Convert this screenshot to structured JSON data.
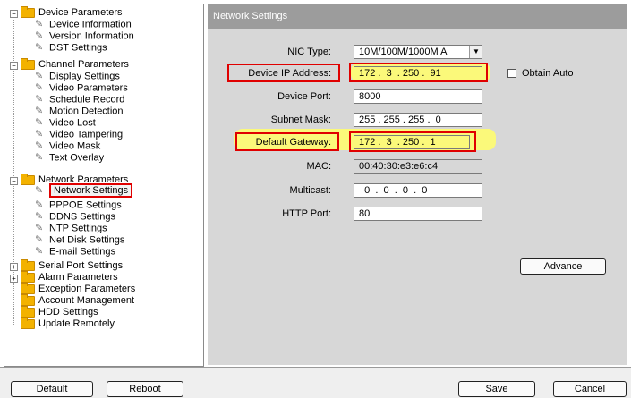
{
  "tree": {
    "device_parameters": "Device Parameters",
    "device_information": "Device Information",
    "version_information": "Version Information",
    "dst_settings": "DST Settings",
    "channel_parameters": "Channel Parameters",
    "display_settings": "Display Settings",
    "video_parameters": "Video Parameters",
    "schedule_record": "Schedule Record",
    "motion_detection": "Motion Detection",
    "video_lost": "Video Lost",
    "video_tampering": "Video Tampering",
    "video_mask": "Video Mask",
    "text_overlay": "Text Overlay",
    "network_parameters": "Network Parameters",
    "network_settings": "Network Settings",
    "pppoe_settings": "PPPOE Settings",
    "ddns_settings": "DDNS Settings",
    "ntp_settings": "NTP Settings",
    "net_disk_settings": "Net Disk Settings",
    "email_settings": "E-mail Settings",
    "serial_port_settings": "Serial Port Settings",
    "alarm_parameters": "Alarm Parameters",
    "exception_parameters": "Exception Parameters",
    "account_management": "Account Management",
    "hdd_settings": "HDD Settings",
    "update_remotely": "Update Remotely"
  },
  "panel": {
    "title": "Network Settings",
    "nic_type_label": "NIC Type:",
    "nic_type_value": "10M/100M/1000M A",
    "ip_label": "Device IP Address:",
    "ip_value": "172 .  3  . 250 .  91",
    "obtain_auto_label": "Obtain Auto",
    "port_label": "Device Port:",
    "port_value": "8000",
    "subnet_label": "Subnet Mask:",
    "subnet_value": "255 . 255 . 255 .  0",
    "gateway_label": "Default Gateway:",
    "gateway_value": "172 .  3  . 250 .  1",
    "mac_label": "MAC:",
    "mac_value": "00:40:30:e3:e6:c4",
    "multicast_label": "Multicast:",
    "multicast_value": "  0  .  0  .  0  .  0",
    "http_port_label": "HTTP Port:",
    "http_port_value": "80",
    "advance_label": "Advance"
  },
  "buttons": {
    "default": "Default",
    "reboot": "Reboot",
    "save": "Save",
    "cancel": "Cancel"
  },
  "colors": {
    "highlight_box": "#e00000",
    "header_bar": "#9c9c9c",
    "panel_bg": "#d7d7d7",
    "folder": "#f3b200",
    "marker": "#fbf97a"
  }
}
